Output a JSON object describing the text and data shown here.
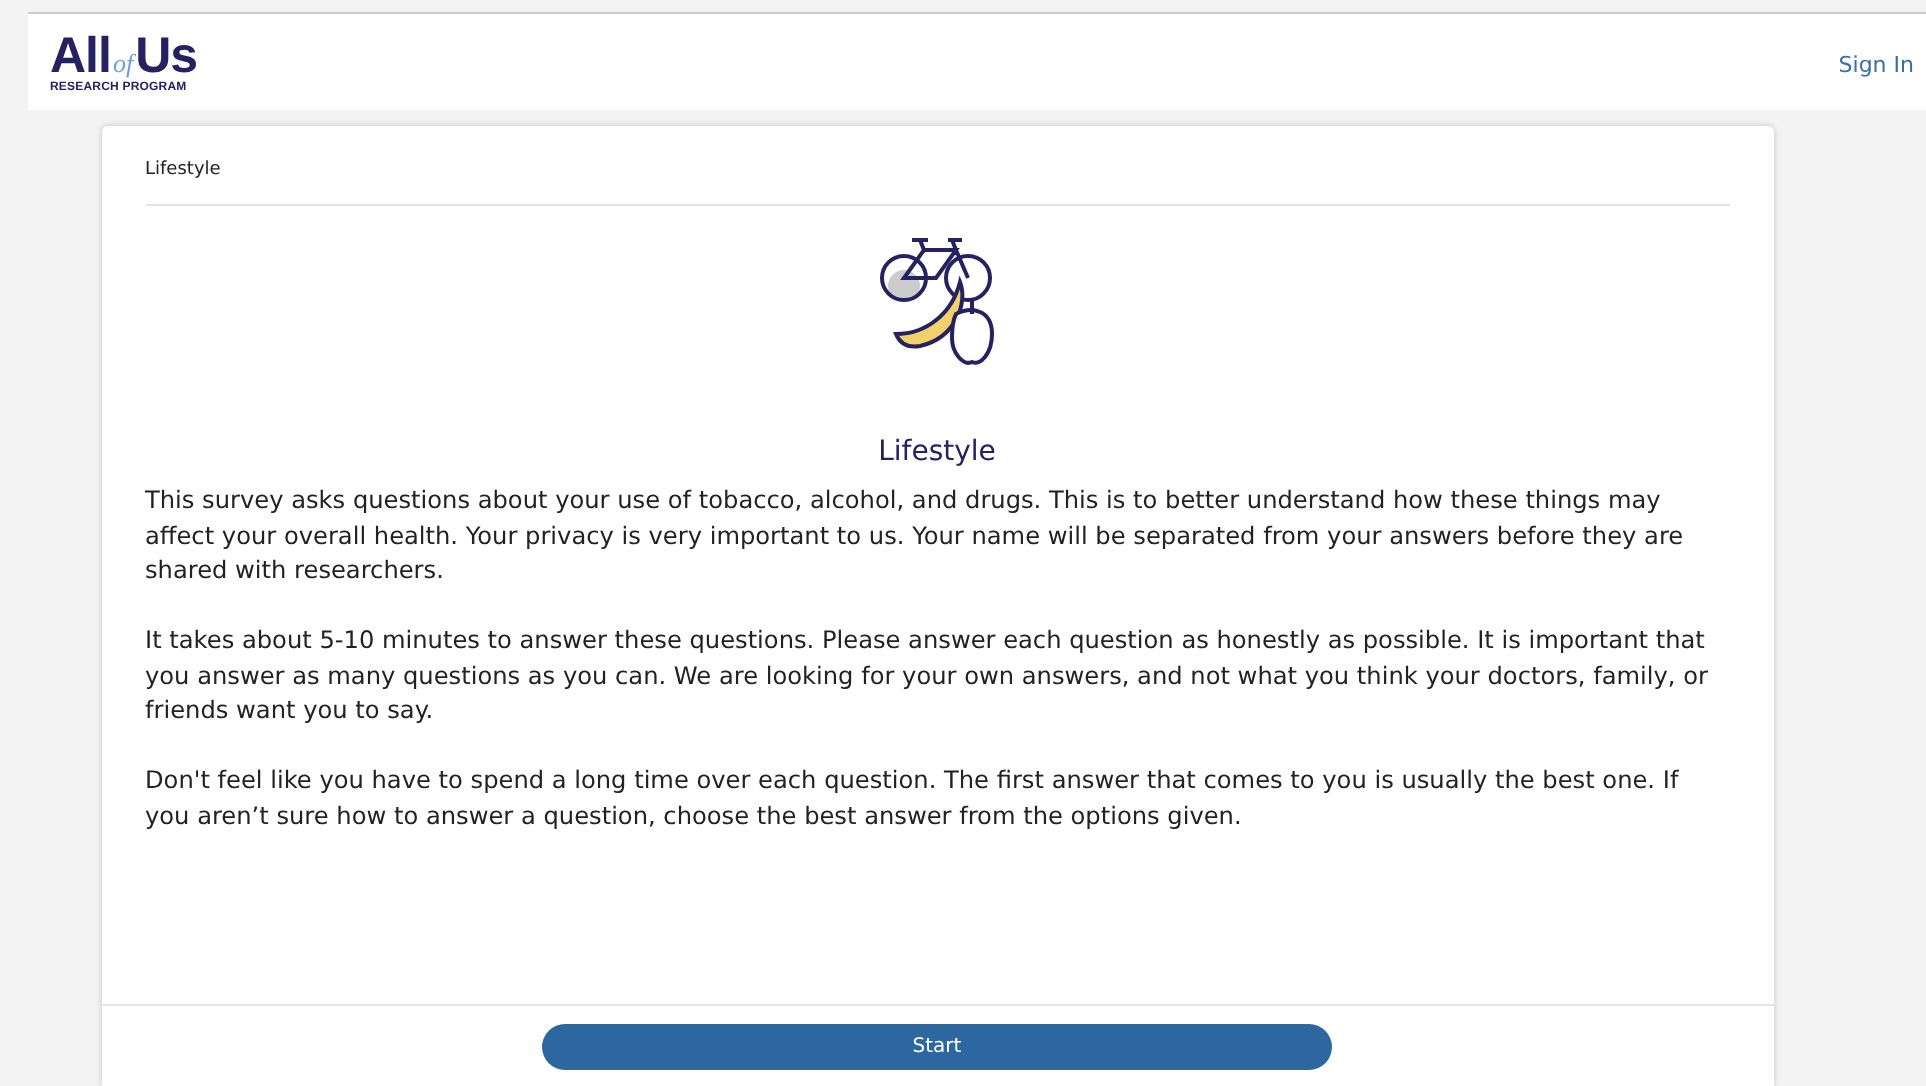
{
  "header": {
    "logo": {
      "word_1": "All",
      "word_2": "of",
      "word_3": "Us",
      "subtitle": "RESEARCH PROGRAM"
    },
    "sign_in": "Sign In"
  },
  "survey": {
    "breadcrumb": "Lifestyle",
    "title": "Lifestyle",
    "paragraphs": [
      "This survey asks questions about your use of tobacco, alcohol, and drugs. This is to better understand how these things may affect your overall health. Your privacy is very important to us. Your name will be separated from your answers before they are shared with researchers.",
      "It takes about 5-10 minutes to answer these questions. Please answer each question as honestly as possible. It is important that you answer as many questions as you can. We are looking for your own answers, and not what you think your doctors, family, or friends want you to say.",
      "Don't feel like you have to spend a long time over each question. The first answer that comes to you is usually the best one. If you aren’t sure how to answer a question, choose the best answer from the options given."
    ],
    "start_button": "Start"
  }
}
